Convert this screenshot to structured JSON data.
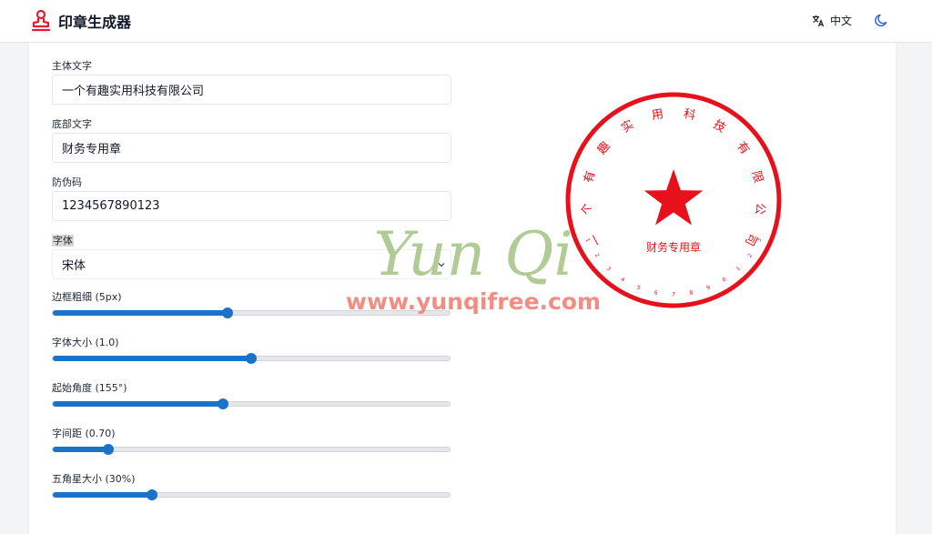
{
  "app": {
    "title": "印章生成器"
  },
  "header": {
    "language_label": "中文"
  },
  "form": {
    "main_text_label": "主体文字",
    "main_text_value": "一个有趣实用科技有限公司",
    "bottom_text_label": "底部文字",
    "bottom_text_value": "财务专用章",
    "security_code_label": "防伪码",
    "security_code_value": "1234567890123",
    "font_label": "字体",
    "font_value": "宋体"
  },
  "sliders": [
    {
      "label": "边框粗细 (5px)",
      "fraction": 0.44
    },
    {
      "label": "字体大小 (1.0)",
      "fraction": 0.5
    },
    {
      "label": "起始角度 (155°)",
      "fraction": 0.43
    },
    {
      "label": "字间距 (0.70)",
      "fraction": 0.14
    },
    {
      "label": "五角星大小 (30%)",
      "fraction": 0.25
    }
  ],
  "seal": {
    "color": "#e8101a",
    "ring_text": "一个有趣实用科技有限公司",
    "bottom_text": "财务专用章",
    "code_text": "1234567890123"
  },
  "watermark": {
    "script": "Yun Qi",
    "url": "www.yunqifree.com"
  },
  "colors": {
    "accent": "#1a73c8",
    "stamp_red": "#e8101a"
  }
}
